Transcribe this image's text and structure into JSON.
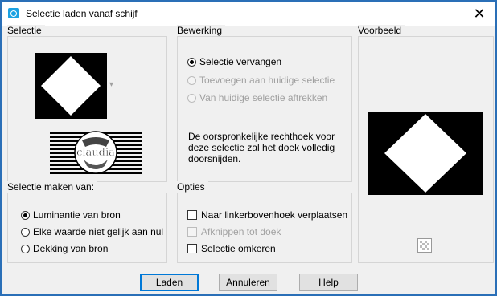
{
  "window": {
    "title": "Selectie laden vanaf schijf",
    "close_label": "✕"
  },
  "selectie": {
    "label": "Selectie",
    "dropdown_arrow": "▾"
  },
  "bewerking": {
    "label": "Bewerking",
    "options": [
      {
        "label": "Selectie vervangen",
        "checked": true,
        "disabled": false
      },
      {
        "label": "Toevoegen aan huidige selectie",
        "checked": false,
        "disabled": true
      },
      {
        "label": "Van huidige selectie aftrekken",
        "checked": false,
        "disabled": true
      }
    ],
    "description_line1": "De oorspronkelijke rechthoek voor",
    "description_line2": "deze selectie zal het doek volledig",
    "description_line3": "doorsnijden."
  },
  "voorbeeld": {
    "label": "Voorbeeld"
  },
  "maken_van": {
    "label": "Selectie maken van:",
    "options": [
      {
        "label": "Luminantie van bron",
        "checked": true
      },
      {
        "label": "Elke waarde niet gelijk aan nul",
        "checked": false
      },
      {
        "label": "Dekking van bron",
        "checked": false
      }
    ]
  },
  "opties": {
    "label": "Opties",
    "items": [
      {
        "label": "Naar linkerbovenhoek verplaatsen",
        "checked": false,
        "disabled": false
      },
      {
        "label": "Afknippen tot doek",
        "checked": false,
        "disabled": true
      },
      {
        "label": "Selectie omkeren",
        "checked": false,
        "disabled": false
      }
    ]
  },
  "buttons": {
    "load": "Laden",
    "cancel": "Annuleren",
    "help": "Help"
  },
  "colors": {
    "window_border": "#2a6fb7",
    "dialog_bg": "#f0f0f0",
    "default_button_border": "#0078d7"
  },
  "logo_text": "claudia"
}
